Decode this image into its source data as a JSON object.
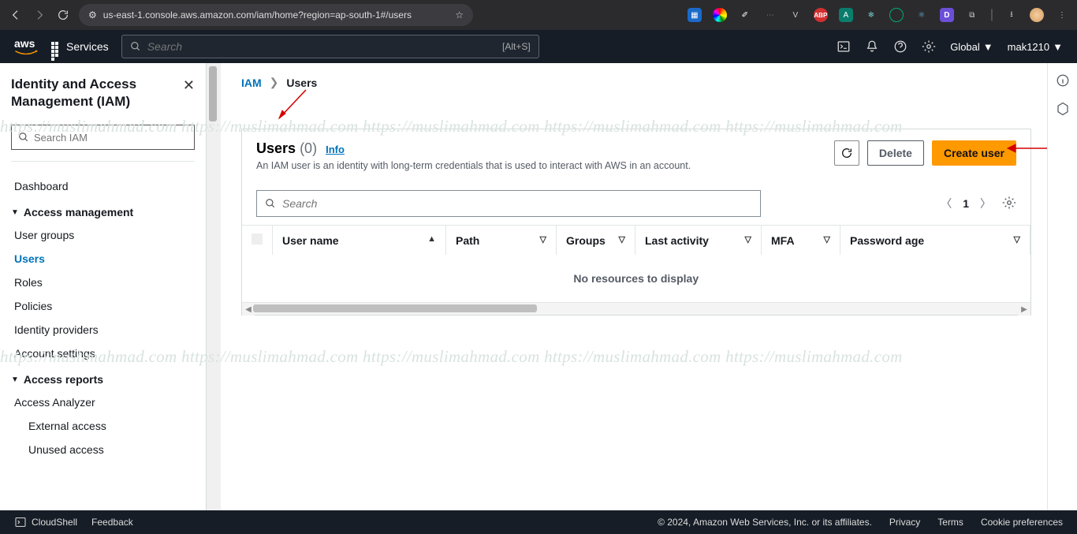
{
  "browser": {
    "url": "us-east-1.console.aws.amazon.com/iam/home?region=ap-south-1#/users"
  },
  "aws_nav": {
    "services_label": "Services",
    "search_placeholder": "Search",
    "search_hint": "[Alt+S]",
    "region_label": "Global",
    "user_label": "mak1210"
  },
  "sidebar": {
    "title": "Identity and Access Management (IAM)",
    "search_placeholder": "Search IAM",
    "items": {
      "dashboard": "Dashboard",
      "access_mgmt": "Access management",
      "user_groups": "User groups",
      "users": "Users",
      "roles": "Roles",
      "policies": "Policies",
      "identity_providers": "Identity providers",
      "account_settings": "Account settings",
      "access_reports": "Access reports",
      "access_analyzer": "Access Analyzer",
      "external_access": "External access",
      "unused_access": "Unused access"
    }
  },
  "breadcrumb": {
    "root": "IAM",
    "current": "Users"
  },
  "panel": {
    "title": "Users",
    "count": "(0)",
    "info": "Info",
    "description": "An IAM user is an identity with long-term credentials that is used to interact with AWS in an account.",
    "actions": {
      "delete": "Delete",
      "create": "Create user"
    },
    "table_search_placeholder": "Search",
    "page_number": "1",
    "columns": {
      "user_name": "User name",
      "path": "Path",
      "groups": "Groups",
      "last_activity": "Last activity",
      "mfa": "MFA",
      "password_age": "Password age"
    },
    "empty": "No resources to display"
  },
  "footer": {
    "cloudshell": "CloudShell",
    "feedback": "Feedback",
    "copyright": "© 2024, Amazon Web Services, Inc. or its affiliates.",
    "privacy": "Privacy",
    "terms": "Terms",
    "cookie": "Cookie preferences"
  },
  "watermark": "https://muslimahmad.com   https://muslimahmad.com   https://muslimahmad.com   https://muslimahmad.com   https://muslimahmad.com"
}
